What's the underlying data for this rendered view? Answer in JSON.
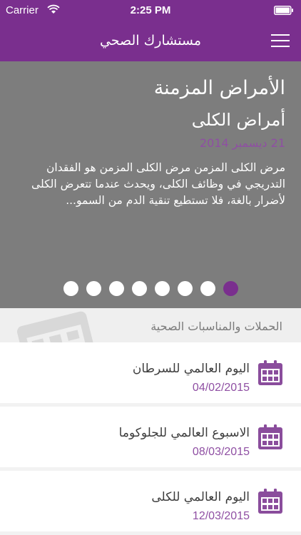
{
  "status_bar": {
    "carrier": "Carrier",
    "time": "2:25 PM",
    "wifi_icon": "wifi-icon",
    "battery_icon": "battery-icon"
  },
  "nav": {
    "title": "مستشارك الصحي",
    "menu_icon": "hamburger-icon"
  },
  "featured": {
    "category": "الأمراض المزمنة",
    "title": "أمراض الكلى",
    "date": "21 ديسمبر 2014",
    "excerpt": "مرض الكلى المزمن    مرض الكلى المزمن هو الفقدان التدريجي في وظائف الكلى، ويحدث عندما تتعرض الكلى لأضرار بالغة، فلا تستطيع تنقية الدم من السمو...",
    "page_count": 8,
    "active_page": 8
  },
  "section": {
    "title": "الحملات والمناسبات الصحية",
    "watermark_icon": "calendar-icon"
  },
  "events": [
    {
      "title": "اليوم العالمي للسرطان",
      "date": "04/02/2015",
      "icon": "calendar-icon"
    },
    {
      "title": "الاسبوع العالمي للجلوكوما",
      "date": "08/03/2015",
      "icon": "calendar-icon"
    },
    {
      "title": "اليوم العالمي للكلى",
      "date": "12/03/2015",
      "icon": "calendar-icon"
    }
  ],
  "colors": {
    "brand": "#7a2f8e",
    "hero_bg": "#7d7d7d",
    "date_text": "#8f4fa3",
    "section_text": "#7b7b7b"
  }
}
